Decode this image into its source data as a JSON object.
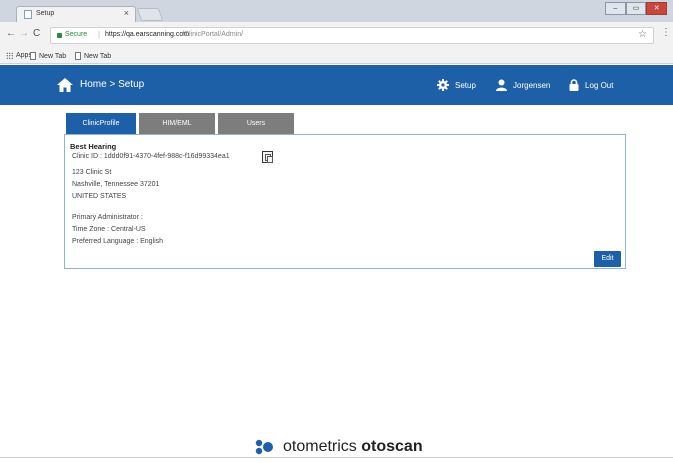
{
  "browser": {
    "tab_title": "Setup",
    "tab_close": "×",
    "secure_label": "Secure",
    "url_host": "https://qa.earscanning.com",
    "url_path": "/ClinicPortal/Admin/",
    "window_buttons": [
      "–",
      "▭",
      "✕"
    ],
    "bookmarks": {
      "apps": "Apps",
      "new_tab_1": "New Tab",
      "new_tab_2": "New Tab"
    }
  },
  "header": {
    "breadcrumb": "Home > Setup",
    "setup_label": "Setup",
    "user_label": "Jorgensen",
    "logout_label": "Log Out"
  },
  "tabs": [
    {
      "label": "ClinicProfile"
    },
    {
      "label": "HIM/EML"
    },
    {
      "label": "Users"
    }
  ],
  "clinic": {
    "name": "Best Hearing",
    "id_line": "Clinic ID : 1ddd0f91-4370-4fef-988c-f16d99334ea1",
    "address_line1": "123 Clinic St",
    "address_line2": "Nashville, Tennessee 37201",
    "address_line3": "UNITED STATES",
    "admin_line": "Primary Administrator :",
    "timezone_line": "Time Zone : Central-US",
    "language_line": "Preferred Language : English",
    "edit_label": "Edit"
  },
  "footer": {
    "brand_light": "otometrics ",
    "brand_bold": "otoscan"
  },
  "colors": {
    "header_blue": "#1e60a8",
    "inactive_tab": "#7d7d7d"
  }
}
